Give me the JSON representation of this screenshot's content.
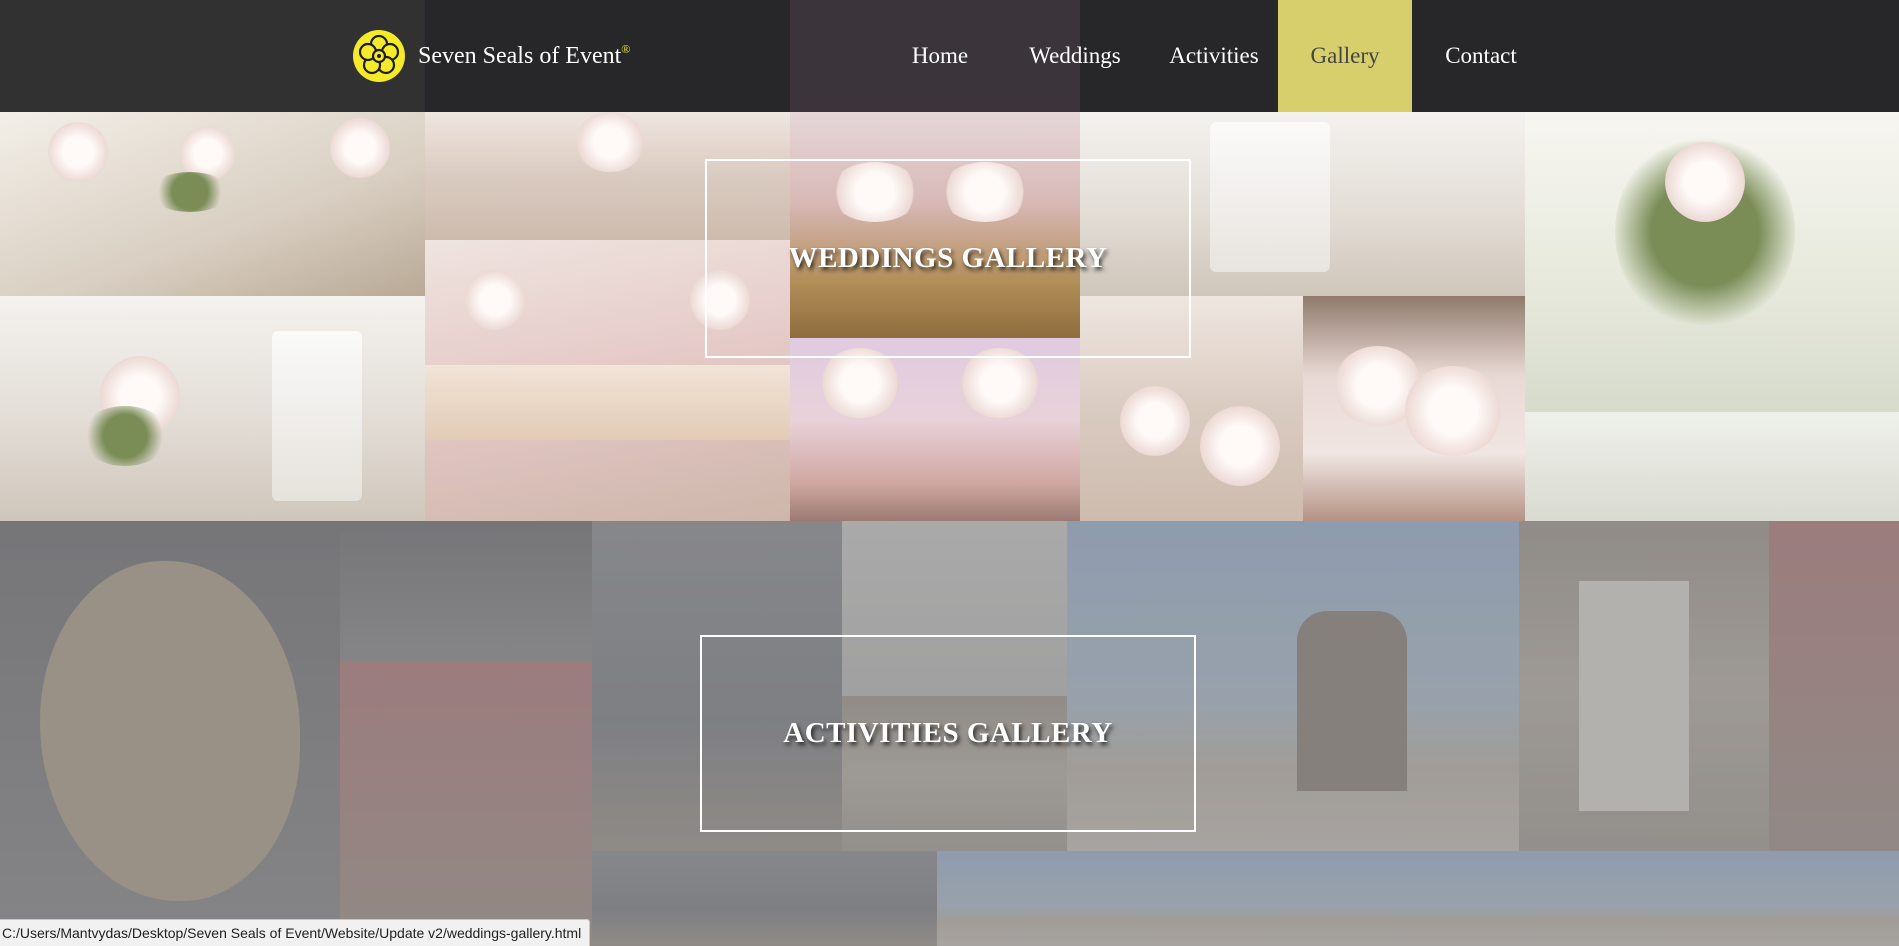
{
  "brand": {
    "name": "Seven Seals of Event",
    "mark": "®"
  },
  "nav": {
    "items": [
      {
        "label": "Home"
      },
      {
        "label": "Weddings"
      },
      {
        "label": "Activities"
      },
      {
        "label": "Gallery",
        "active": true
      },
      {
        "label": "Contact"
      }
    ]
  },
  "sections": {
    "weddings_label": "WEDDINGS GALLERY",
    "activities_label": "ACTIVITIES GALLERY"
  },
  "status_bar": {
    "url": "C:/Users/Mantvydas/Desktop/Seven Seals of Event/Website/Update v2/weddings-gallery.html"
  },
  "colors": {
    "header_bg": "#27272a",
    "nav_active_bg": "#d6cf6b",
    "logo_yellow": "#f4ea2a"
  },
  "icons": {
    "logo": "seal-flower-icon"
  }
}
